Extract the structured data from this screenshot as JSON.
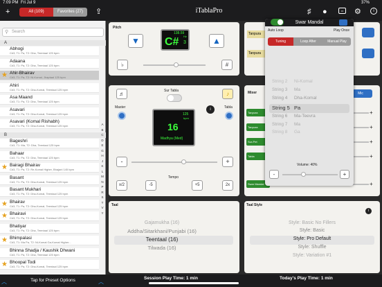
{
  "status": {
    "time": "7:09 PM",
    "date": "Fri Jul 9",
    "battery": "37%"
  },
  "toolbar": {
    "all": "All (109)",
    "favorites": "Favorites (27)",
    "title": "iTablaPro",
    "plus": "+",
    "share": "⇪",
    "gear": "⚙",
    "info": "i"
  },
  "sidebar": {
    "search_placeholder": "Search",
    "section_a": "A",
    "section_b": "B",
    "items_a": [
      {
        "name": "Abhogi",
        "desc": "C#3, T1: Pa, T2: Dha, Teentaal 125 bpm",
        "star": false
      },
      {
        "name": "Adaana",
        "desc": "C#3, T1: Pa, T2: Dha, Teentaal 125 bpm",
        "star": false
      },
      {
        "name": "Ahir-Bhairav",
        "desc": "C#3, T1: Pa, T2: Ni-Komal, Jhaptaal 125 bpm",
        "star": true,
        "selected": true
      },
      {
        "name": "Ahiri",
        "desc": "C#3, T1: Pa, T2: Dha-Komal, Teentaal 125 bpm",
        "star": false
      },
      {
        "name": "Asa Maand",
        "desc": "C#3, T1: Pa, T2: Dha, Teentaal 125 bpm",
        "star": false
      },
      {
        "name": "Asavari",
        "desc": "C#3, T1: Pa, T2: Dha-Komal, Teentaal 125 bpm",
        "star": false
      },
      {
        "name": "Asavari (Komal Rishabh)",
        "desc": "C#3, T1: Pa, T2: Dha-Komal, Teentaal 125 bpm",
        "star": false
      }
    ],
    "items_b": [
      {
        "name": "Bageshri",
        "desc": "C#3, T1: Ma, T2: Dha, Teentaal 125 bpm",
        "star": false
      },
      {
        "name": "Bahaar",
        "desc": "C#3, T1: Pa, T2: Dha, Teentaal 125 bpm",
        "star": false
      },
      {
        "name": "Bairagi Bhairav",
        "desc": "C#3, T1: Pa, T2: Re-Komal Higher, Bhajani 145 bpm",
        "star": true
      },
      {
        "name": "Basant",
        "desc": "C#3, T1: Pa, T2: Dha-Komal, Teentaal 125 bpm",
        "star": false
      },
      {
        "name": "Basant Mukhari",
        "desc": "C#3, T1: Pa, T2: Dha-Komal, Teentaal 125 bpm",
        "star": false
      },
      {
        "name": "Bhairav",
        "desc": "C#3, T1: Pa, T2: Dha-Komal, Teentaal 125 bpm",
        "star": true
      },
      {
        "name": "Bhairavi",
        "desc": "C#3, T1: Pa, T2: Dha-Komal, Teentaal 125 bpm",
        "star": true
      },
      {
        "name": "Bhatiyar",
        "desc": "C#3, T1: Pa, T2: Dha, Teentaal 125 bpm",
        "star": false
      },
      {
        "name": "Bhimpalasi",
        "desc": "C#3, T1: Ma Pa, T2: Ni-Komal Ga-Komal Higher...",
        "star": true
      },
      {
        "name": "Bhinna Shadja / Kaushik Dhwani",
        "desc": "C#3, T1: Pa, T2: Dha, Teentaal 125 bpm",
        "star": false
      },
      {
        "name": "Bhoopal Todi",
        "desc": "C#3, T1: Pa, T2: Dha-Komal, Teentaal 125 bpm",
        "star": true
      }
    ],
    "index": [
      "A",
      "B",
      "C",
      "D",
      "E",
      "G",
      "H",
      "J",
      "K",
      "L",
      "M",
      "N",
      "P",
      "R",
      "S",
      "T",
      "V",
      "Y"
    ],
    "tap_label": "Tap for Preset Options"
  },
  "pitch": {
    "label": "Pitch",
    "freq": "138.59",
    "hz": "Hz",
    "note": "C#",
    "octave": "3",
    "flat": "♭",
    "sharp": "#"
  },
  "sur": {
    "label": "Sur Tabla",
    "master": "Master",
    "tabla": "Tabla"
  },
  "tempo": {
    "bpm_value": "16",
    "bpm_small": "125",
    "bpm_unit": "bpm",
    "taal_name": "Madhya (Med)",
    "label": "Tempo",
    "minus": "-",
    "plus": "+",
    "half": "x/2",
    "m5": "-5",
    "p5": "+5",
    "double": "2x"
  },
  "tanpura": {
    "label": "Tanpura",
    "label2": "Tanpura"
  },
  "mixer": {
    "label": "Mixer",
    "mic": "Mic",
    "rows": [
      "Tanpura",
      "Tanpura",
      "Sur-Pet",
      "Tabla",
      "Swar Mandal"
    ]
  },
  "taal": {
    "label": "Taal",
    "items": [
      "Gajamukha (16)",
      "Addha/Sitarkhani/Punjabi (16)",
      "Teentaal (16)",
      "Tilwada (16)"
    ]
  },
  "taal_style": {
    "label": "Taal Style",
    "items": [
      "Style: Basic No Fillers",
      "Style: Basic",
      "Style: Pro Default",
      "Style: Shuffle",
      "Style: Variation #1"
    ]
  },
  "footer": {
    "session": "Session Play Time: 1 min",
    "today": "Today's Play Time: 1 min"
  },
  "swar": {
    "title": "Swar Mandal",
    "auto_loop": "Auto Loop",
    "play_once": "Play Once",
    "tabs": [
      "Tuning",
      "Loop After",
      "Manual Play"
    ],
    "strings": [
      [
        "String 2",
        "Ni-Komal"
      ],
      [
        "String 3",
        "Ma"
      ],
      [
        "String 4",
        "Dha-Komal"
      ],
      [
        "String 5",
        "Pa"
      ],
      [
        "String 6",
        "Ma-Teevra"
      ],
      [
        "String 7",
        "Ma"
      ],
      [
        "String 8",
        "Ga"
      ]
    ],
    "volume": "Volume: 40%"
  },
  "accent_red": "#c62828",
  "accent_blue": "#2f6fc4",
  "accent_green": "#2e8b2e",
  "lcd_green": "#3cff3c"
}
